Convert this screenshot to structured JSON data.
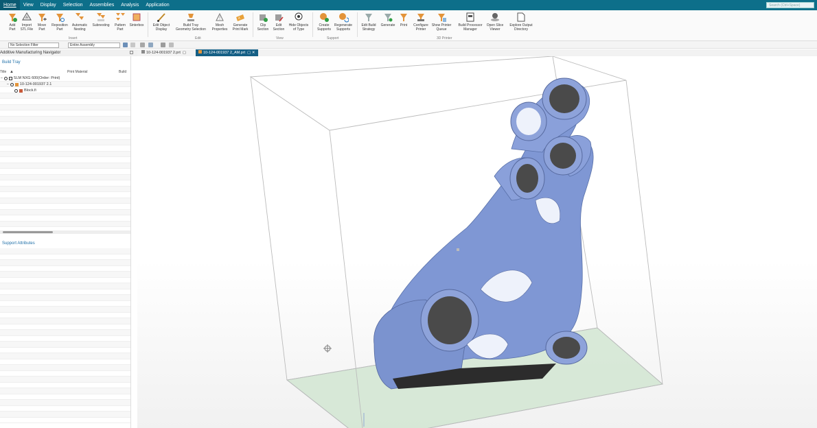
{
  "menu": {
    "items": [
      "Home",
      "View",
      "Display",
      "Selection",
      "Assemblies",
      "Analysis",
      "Application"
    ],
    "search_placeholder": "Search (Ctrl+Space)"
  },
  "ribbon": {
    "buttons": [
      {
        "label": "Add\nPart",
        "icon": "add-part-icon"
      },
      {
        "label": "Import\nSTL File",
        "icon": "import-stl-icon"
      },
      {
        "label": "Move\nPart",
        "icon": "move-part-icon"
      },
      {
        "label": "Reposition\nPart",
        "icon": "reposition-part-icon"
      },
      {
        "label": "Automatic\nNesting",
        "icon": "automatic-nesting-icon"
      },
      {
        "label": "Subnesting",
        "icon": "subnesting-icon"
      },
      {
        "label": "Pattern\nPart",
        "icon": "pattern-part-icon"
      },
      {
        "label": "Sinterbox",
        "icon": "sinterbox-icon"
      },
      {
        "label": "Edit Object\nDisplay",
        "icon": "edit-object-display-icon"
      },
      {
        "label": "Build Tray\nGeometry Selection",
        "icon": "build-tray-icon"
      },
      {
        "label": "Mesh\nProperties",
        "icon": "mesh-properties-icon"
      },
      {
        "label": "Generate\nPrint Mark",
        "icon": "print-mark-icon"
      },
      {
        "label": "Clip\nSection",
        "icon": "clip-section-icon"
      },
      {
        "label": "Edit\nSection",
        "icon": "edit-section-icon"
      },
      {
        "label": "Hide Objects\nof Type",
        "icon": "hide-objects-icon"
      },
      {
        "label": "Create\nSupports",
        "icon": "create-supports-icon"
      },
      {
        "label": "Regenerate\nSupports",
        "icon": "regenerate-supports-icon"
      },
      {
        "label": "Edit Build\nStrategy",
        "icon": "edit-build-strategy-icon"
      },
      {
        "label": "Generate",
        "icon": "generate-icon"
      },
      {
        "label": "Print",
        "icon": "print-icon"
      },
      {
        "label": "Configure\nPrinter",
        "icon": "configure-printer-icon"
      },
      {
        "label": "Show Printer\nQueue",
        "icon": "printer-queue-icon"
      },
      {
        "label": "Build Processor\nManager",
        "icon": "build-processor-icon"
      },
      {
        "label": "Open Slice\nViewer",
        "icon": "slice-viewer-icon"
      },
      {
        "label": "Explore Output\nDirectory",
        "icon": "explore-output-icon"
      }
    ],
    "groups": [
      "Insert",
      "Edit",
      "View",
      "Support",
      "3D Printer"
    ]
  },
  "toolbar": {
    "selection_filter": "No Selection Filter",
    "assembly_scope": "Entire Assembly"
  },
  "navigator": {
    "title": "Additive Manufacturing Navigator",
    "build_tray_title": "Build Tray",
    "columns": [
      "Title",
      "Print Material",
      "Build"
    ],
    "tree": [
      {
        "label": "SLM NXG 600(Order: Print)"
      },
      {
        "label": "10-124-001937 2.1"
      },
      {
        "label": "Block.fi"
      }
    ],
    "support_attributes_title": "Support Attributes"
  },
  "tabs": [
    {
      "label": "10-124-001937 2.prt",
      "active": false
    },
    {
      "label": "10-124-001937 2_AM.prt",
      "active": true
    }
  ],
  "colors": {
    "menubar": "#0d6f8a",
    "active_tab": "#155f85",
    "part": "#7f97d4",
    "tray_plate": "#cfe5cf"
  }
}
